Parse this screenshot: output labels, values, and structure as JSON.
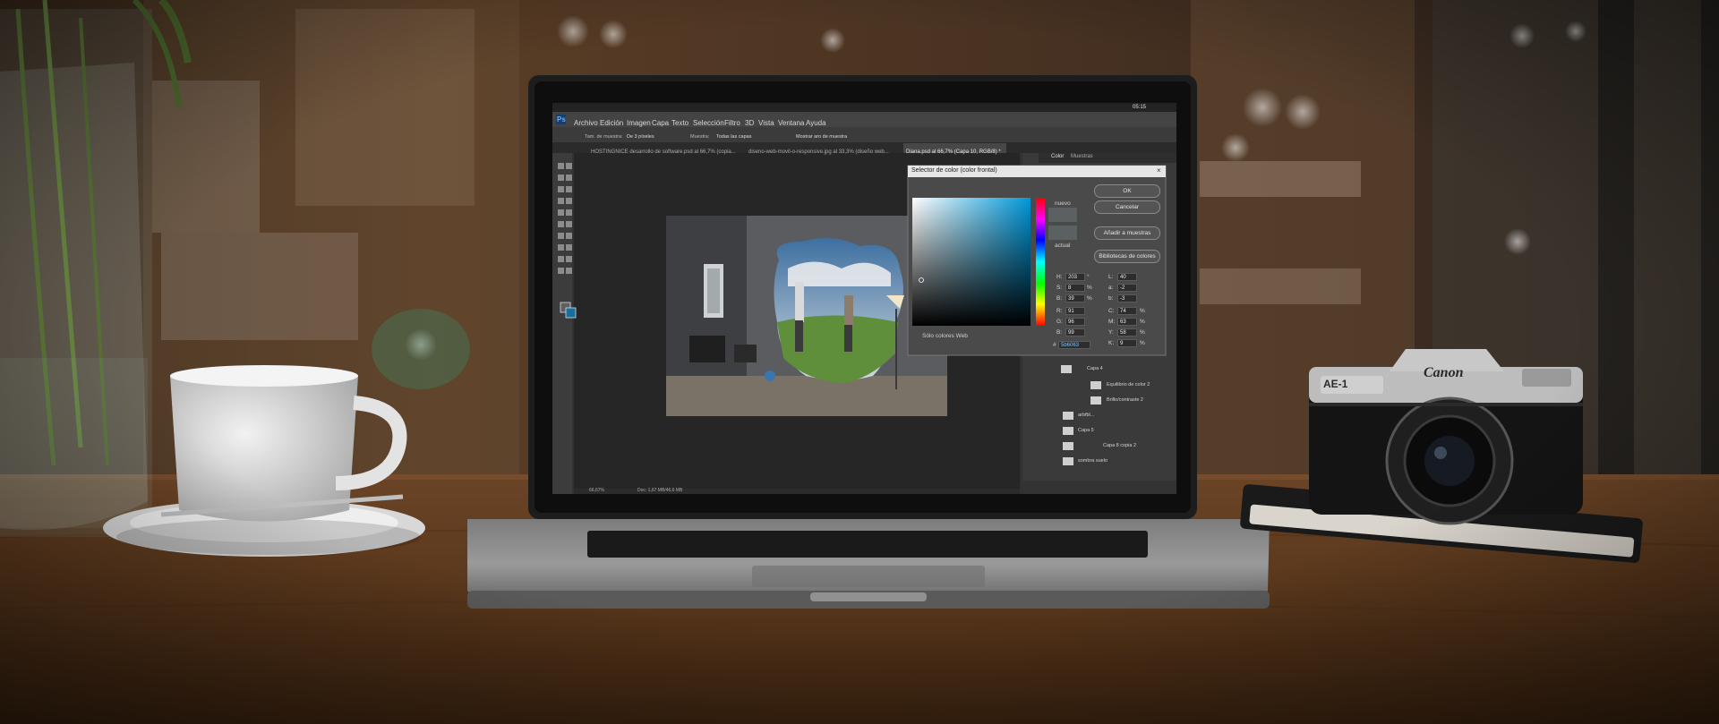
{
  "photoshop": {
    "app_badge": "Ps",
    "clock": "05:15",
    "menu": [
      "Archivo",
      "Edición",
      "Imagen",
      "Capa",
      "Texto",
      "Selección",
      "Filtro",
      "3D",
      "Vista",
      "Ventana",
      "Ayuda"
    ],
    "options_bar": {
      "sample_size_label": "Tam. de muestra:",
      "sample_size_value": "De 3 píxeles",
      "sample_label": "Muestra:",
      "sample_value": "Todas las capas",
      "show_ring_label": "Mostrar aro de muestra"
    },
    "document_tabs": [
      "HOSTINGNICE desarrollo de software.psd al 66,7% (copia...",
      "diseno-web-movil-o-responsive.jpg al 33,3% (diseño web...",
      "Diana.psd al 66,7% (Capa 10, RGB/8) *"
    ],
    "status_bar": {
      "zoom": "66,67%",
      "doc_info": "Doc: 1,67 MB/46,6 MB"
    },
    "panel_tabs": [
      "Color",
      "Muestras"
    ]
  },
  "color_picker": {
    "title": "Selector de color (color frontal)",
    "buttons": [
      "OK",
      "Cancelar",
      "Añadir a muestras",
      "Bibliotecas de colores"
    ],
    "new_label": "nuevo",
    "current_label": "actual",
    "web_colors_label": "Sólo colores Web",
    "hsb": [
      {
        "label": "H:",
        "value": "203",
        "unit": "°"
      },
      {
        "label": "S:",
        "value": "8",
        "unit": "%"
      },
      {
        "label": "B:",
        "value": "39",
        "unit": "%"
      }
    ],
    "rgb": [
      {
        "label": "R:",
        "value": "91"
      },
      {
        "label": "G:",
        "value": "96"
      },
      {
        "label": "B:",
        "value": "99"
      }
    ],
    "lab": [
      {
        "label": "L:",
        "value": "40"
      },
      {
        "label": "a:",
        "value": "-2"
      },
      {
        "label": "b:",
        "value": "-3"
      }
    ],
    "cmyk": [
      {
        "label": "C:",
        "value": "74",
        "unit": "%"
      },
      {
        "label": "M:",
        "value": "63",
        "unit": "%"
      },
      {
        "label": "Y:",
        "value": "58",
        "unit": "%"
      },
      {
        "label": "K:",
        "value": "9",
        "unit": "%"
      }
    ],
    "hex_label": "#",
    "hex": "5b6063",
    "selected_color": "#5b6063"
  },
  "layers": [
    {
      "name": "Capa 4"
    },
    {
      "name": "Equilibrio de color 2"
    },
    {
      "name": "Brillo/contraste 2"
    },
    {
      "name": "arbfbl..."
    },
    {
      "name": "Capa 5"
    },
    {
      "name": "Capa 8 copia 2"
    },
    {
      "name": "sombra suelo"
    }
  ],
  "camera": {
    "brand": "Canon",
    "model": "AE-1"
  }
}
